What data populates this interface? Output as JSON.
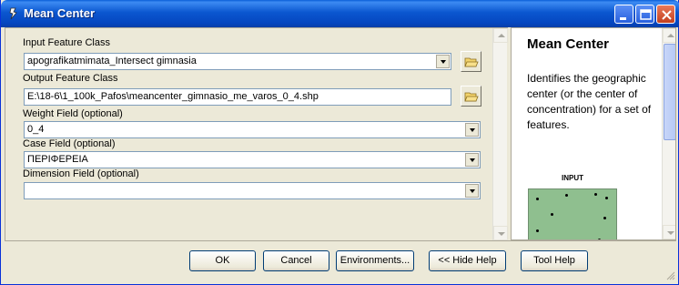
{
  "window": {
    "title": "Mean Center"
  },
  "fields": {
    "input_feature_class": {
      "label": "Input Feature Class",
      "value": "apografikatmimata_Intersect gimnasia"
    },
    "output_feature_class": {
      "label": "Output Feature Class",
      "value": "E:\\18-6\\1_100k_Pafos\\meancenter_gimnasio_me_varos_0_4.shp"
    },
    "weight_field": {
      "label": "Weight Field (optional)",
      "value": "0_4"
    },
    "case_field": {
      "label": "Case Field (optional)",
      "value": "ΠΕΡΙΦΕΡΕΙΑ"
    },
    "dimension_field": {
      "label": "Dimension Field (optional)",
      "value": ""
    }
  },
  "help": {
    "title": "Mean Center",
    "description": "Identifies the geographic center (or the center of concentration) for a set of features.",
    "diagram_label": "INPUT"
  },
  "buttons": {
    "ok": "OK",
    "cancel": "Cancel",
    "environments": "Environments...",
    "hide_help": "<< Hide Help",
    "tool_help": "Tool Help"
  },
  "icons": {
    "title": "tool-icon",
    "browse": "open-folder-icon",
    "minimize": "minimize-icon",
    "maximize": "maximize-icon",
    "close": "close-icon"
  },
  "colors": {
    "titlebar": "#0a5fd8",
    "dialog": "#ece9d8",
    "diagram_fill": "#8fbf8f"
  }
}
